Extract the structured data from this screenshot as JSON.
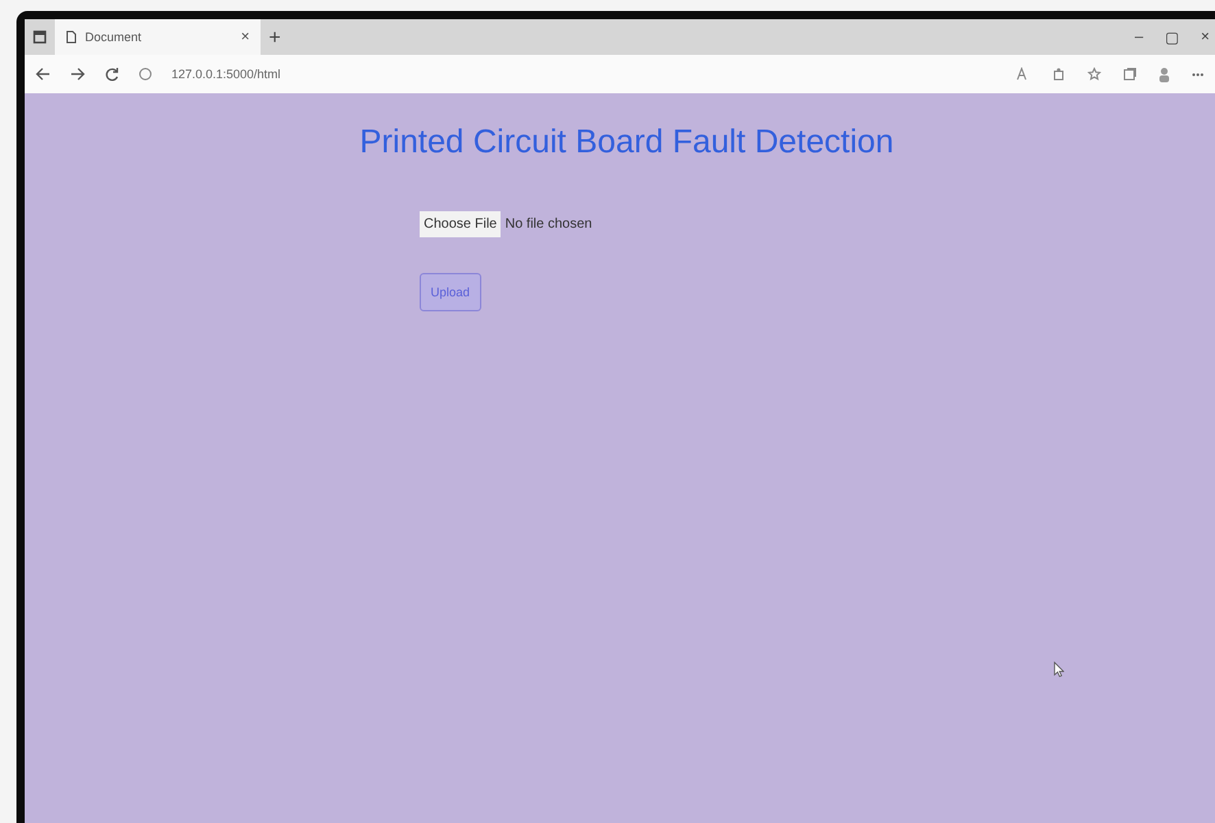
{
  "browser": {
    "tab_title": "Document",
    "tab_close": "×",
    "new_tab": "+",
    "url": "127.0.0.1:5000/html",
    "window_controls": [
      "–",
      "▢",
      "×"
    ]
  },
  "page": {
    "heading": "Printed Circuit Board Fault Detection",
    "choose_file": "Choose File",
    "file_status": "No file chosen",
    "upload": "Upload"
  }
}
